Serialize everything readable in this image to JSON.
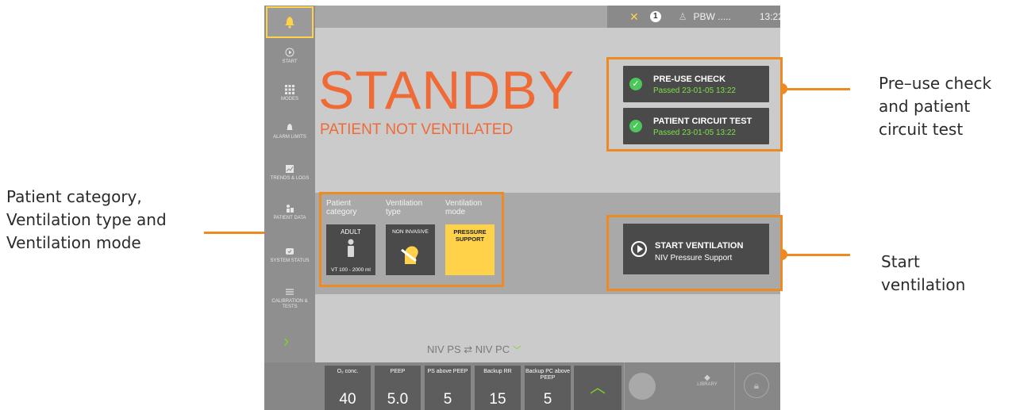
{
  "callouts": {
    "left": [
      "Patient category,",
      "Ventilation type and",
      "Ventilation mode"
    ],
    "right_top": [
      "Pre–use check",
      "and patient",
      "circuit test"
    ],
    "right_bottom": [
      "Start",
      "ventilation"
    ]
  },
  "sidebar": {
    "items": [
      {
        "label": "START",
        "icon": "play-circle-icon"
      },
      {
        "label": "MODES",
        "icon": "grid-icon"
      },
      {
        "label": "ALARM LIMITS",
        "icon": "alarm-icon"
      },
      {
        "label": "TRENDS & LOGS",
        "icon": "trends-icon"
      },
      {
        "label": "PATIENT DATA",
        "icon": "patient-icon"
      },
      {
        "label": "SYSTEM STATUS",
        "icon": "system-icon"
      },
      {
        "label": "CALIBRATION & TESTS",
        "icon": "calibration-icon"
      }
    ]
  },
  "topbar": {
    "notice_count": "1",
    "pbw": "PBW .....",
    "time": "13:22"
  },
  "main": {
    "status_title": "STANDBY",
    "status_subtitle": "PATIENT NOT VENTILATED"
  },
  "checks": [
    {
      "title": "PRE-USE CHECK",
      "status": "Passed 23-01-05 13:22"
    },
    {
      "title": "PATIENT CIRCUIT TEST",
      "status": "Passed 23-01-05 13:22"
    }
  ],
  "selection": {
    "category_label": [
      "Patient",
      "category"
    ],
    "type_label": [
      "Ventilation",
      "type"
    ],
    "mode_label": [
      "Ventilation",
      "mode"
    ],
    "category_tile": {
      "title": "ADULT",
      "sub": "VT 100 - 2000 ml"
    },
    "type_tile": {
      "title": "NON INVASIVE"
    },
    "mode_tile": {
      "title": "PRESSURE SUPPORT"
    }
  },
  "start": {
    "title": "START VENTILATION",
    "sub": "NIV Pressure Support"
  },
  "toggle": {
    "label": "NIV PS ⇄ NIV PC"
  },
  "params": [
    {
      "label": "O₂ conc.",
      "value": "40"
    },
    {
      "label": "PEEP",
      "value": "5.0"
    },
    {
      "label": "PS above PEEP",
      "value": "5"
    },
    {
      "label": "Backup RR",
      "value": "15"
    },
    {
      "label": "Backup PC above PEEP",
      "value": "5"
    }
  ],
  "bottom": {
    "library": "LIBRARY"
  },
  "colors": {
    "accent": "#ee8a22",
    "standby": "#f06a36",
    "ok": "#4cc75a",
    "mode": "#ffd24a"
  }
}
